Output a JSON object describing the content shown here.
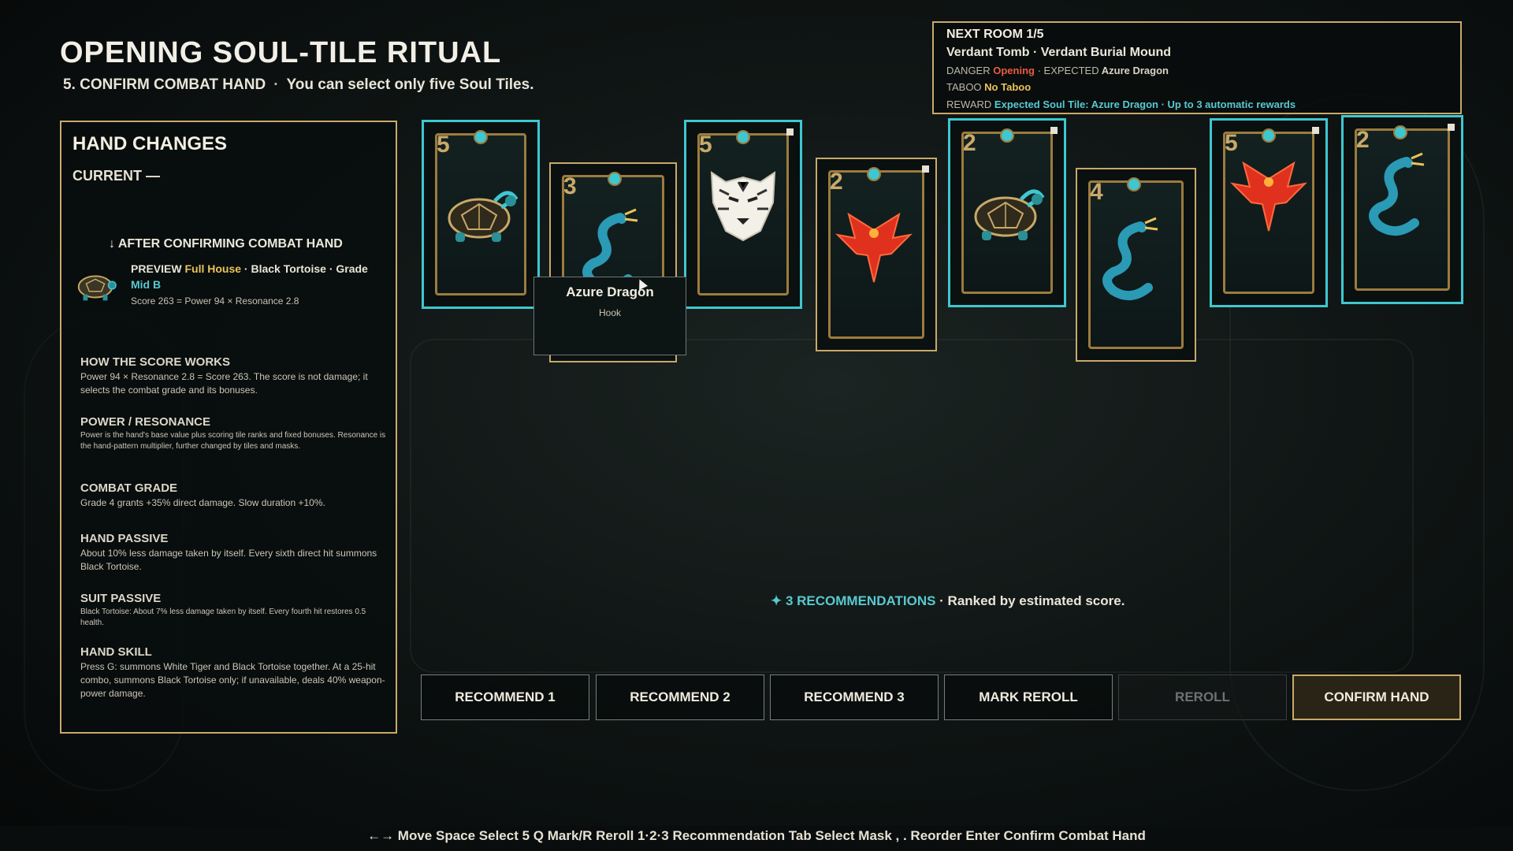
{
  "title": "OPENING SOUL-TILE RITUAL",
  "subtitle": {
    "step": "5. CONFIRM COMBAT HAND",
    "separator": "·",
    "note": "You can select only five Soul Tiles."
  },
  "hand_changes": {
    "title": "HAND CHANGES",
    "current": "CURRENT —",
    "after_heading": "↓  AFTER CONFIRMING COMBAT HAND",
    "preview_label": "PREVIEW",
    "preview_hand": "Full House",
    "preview_sep1": "·",
    "preview_suit": "Black Tortoise",
    "preview_sep2": "·",
    "preview_grade_label": "Grade",
    "preview_grade": "Mid B",
    "score_line": "Score 263  =  Power 94  ×  Resonance 2.8",
    "sections": [
      {
        "heading": "HOW THE SCORE WORKS",
        "body": "Power 94 × Resonance 2.8 = Score 263. The score is not damage; it selects the combat grade and its bonuses."
      },
      {
        "heading": "POWER / RESONANCE",
        "body": "Power is the hand's base value plus scoring tile ranks and fixed bonuses. Resonance is the hand-pattern multiplier, further changed by tiles and masks."
      },
      {
        "heading": "COMBAT GRADE",
        "body": "Grade 4 grants +35% direct damage. Slow duration +10%."
      },
      {
        "heading": "HAND PASSIVE",
        "body": "About 10% less damage taken by itself. Every sixth direct hit summons Black Tortoise."
      },
      {
        "heading": "SUIT PASSIVE",
        "body": "Black Tortoise: About 7% less damage taken by itself. Every fourth hit restores 0.5 health."
      },
      {
        "heading": "HAND SKILL",
        "body": "Press G: summons White Tiger and Black Tortoise together. At a 25-hit combo, summons Black Tortoise only; if unavailable, deals 40% weapon-power damage."
      }
    ]
  },
  "cards": [
    {
      "rank": "5",
      "suit": "tortoise-icon",
      "selected": true
    },
    {
      "rank": "3",
      "suit": "dragon-icon",
      "selected": false
    },
    {
      "rank": "5",
      "suit": "tiger-icon",
      "selected": true
    },
    {
      "rank": "2",
      "suit": "phoenix-icon",
      "selected": false
    },
    {
      "rank": "2",
      "suit": "tortoise-icon",
      "selected": true
    },
    {
      "rank": "4",
      "suit": "dragon-icon",
      "selected": false
    },
    {
      "rank": "5",
      "suit": "phoenix-icon",
      "selected": true
    },
    {
      "rank": "2",
      "suit": "dragon-icon",
      "selected": true
    }
  ],
  "tooltip": {
    "name": "Azure Dragon",
    "sub": "Hook"
  },
  "next_room": {
    "heading": "NEXT ROOM 1/5",
    "location": "Verdant Tomb  ·  Verdant Burial Mound",
    "danger_label": "DANGER",
    "danger_value": "Opening",
    "expected_label": "·  EXPECTED",
    "expected_value": "Azure Dragon",
    "taboo_label": "TABOO",
    "taboo_value": "No Taboo",
    "reward_label": "REWARD",
    "reward_value": "Expected Soul Tile: Azure Dragon  ·  Up to 3 automatic rewards"
  },
  "recommendations": {
    "count_text": "✦ 3 RECOMMENDATIONS",
    "note": "·  Ranked by estimated score."
  },
  "buttons": {
    "rec1": "RECOMMEND 1",
    "rec2": "RECOMMEND 2",
    "rec3": "RECOMMEND 3",
    "mark_reroll": "MARK REROLL",
    "reroll": "REROLL",
    "confirm": "CONFIRM HAND"
  },
  "hints": "←→ Move   Space Select 5   Q Mark/R Reroll   1·2·3 Recommendation   Tab Select Mask   , . Reorder   Enter Confirm Combat Hand",
  "colors": {
    "accent_teal": "#3fc7d0",
    "accent_gold": "#c9a969",
    "danger_red": "#e85b44"
  }
}
